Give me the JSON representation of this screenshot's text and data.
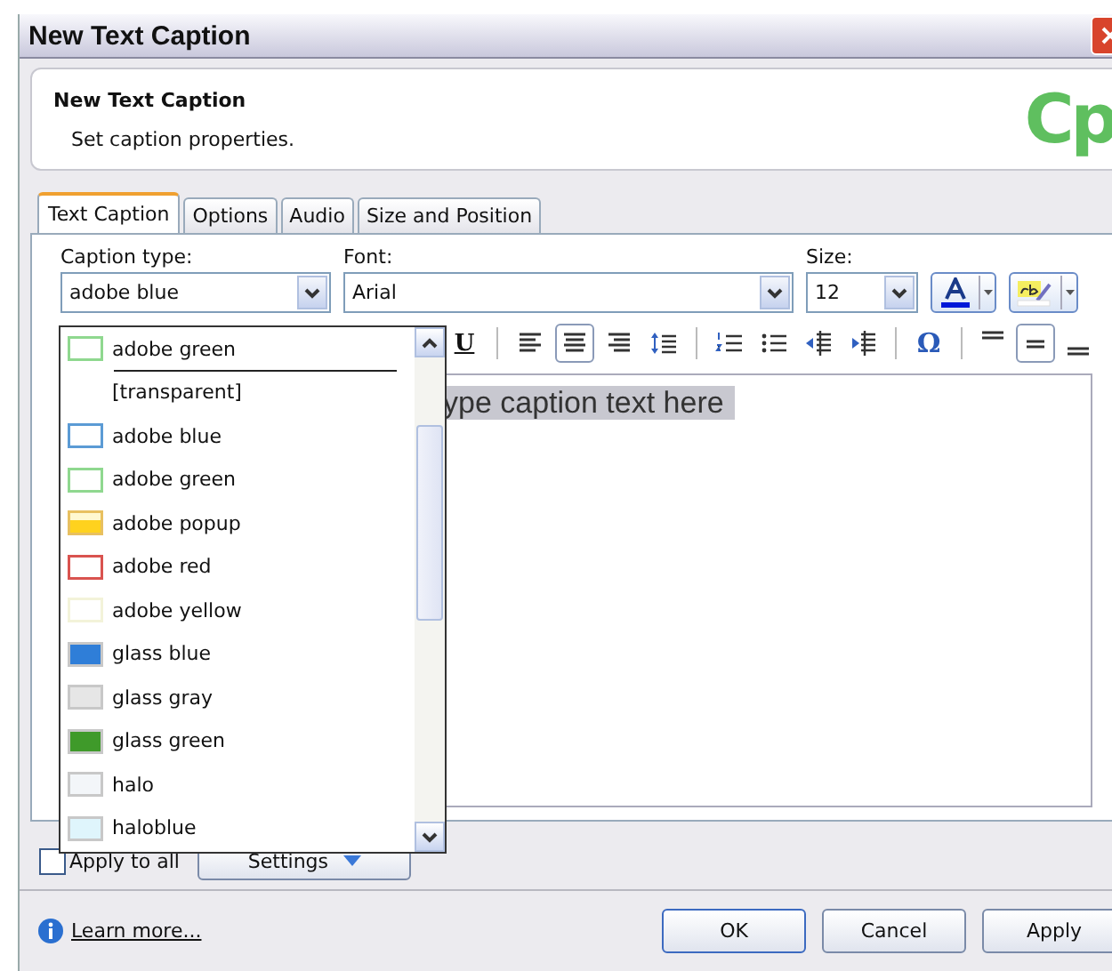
{
  "window": {
    "title": "New Text Caption"
  },
  "header": {
    "title": "New Text Caption",
    "subtitle": "Set caption properties.",
    "logo": "Cp"
  },
  "tabs": [
    {
      "label": "Text Caption",
      "selected": true
    },
    {
      "label": "Options",
      "selected": false
    },
    {
      "label": "Audio",
      "selected": false
    },
    {
      "label": "Size and Position",
      "selected": false
    }
  ],
  "caption_type": {
    "label": "Caption type:",
    "value": "adobe blue"
  },
  "font": {
    "label": "Font:",
    "value": "Arial"
  },
  "size": {
    "label": "Size:",
    "value": "12"
  },
  "toolbar": [
    {
      "kind": "underline",
      "text": "U",
      "pressed": false
    },
    {
      "kind": "separator"
    },
    {
      "kind": "align-left",
      "pressed": false
    },
    {
      "kind": "align-center",
      "pressed": true
    },
    {
      "kind": "align-right",
      "pressed": false
    },
    {
      "kind": "line-spacing",
      "pressed": false
    },
    {
      "kind": "separator"
    },
    {
      "kind": "numbered-list",
      "pressed": false
    },
    {
      "kind": "bullet-list",
      "pressed": false
    },
    {
      "kind": "outdent",
      "pressed": false
    },
    {
      "kind": "indent",
      "pressed": false
    },
    {
      "kind": "separator"
    },
    {
      "kind": "symbol",
      "text": "Ω",
      "pressed": false
    },
    {
      "kind": "separator"
    },
    {
      "kind": "superscript",
      "pressed": false
    },
    {
      "kind": "baseline",
      "pressed": true
    },
    {
      "kind": "subscript",
      "pressed": false
    }
  ],
  "editor": {
    "text": "ype caption text here"
  },
  "dropdown": {
    "recent": [
      {
        "label": "adobe green",
        "kind": "outline",
        "color": "#8fd88f"
      }
    ],
    "items": [
      {
        "label": "[transparent]",
        "kind": "none"
      },
      {
        "label": "adobe blue",
        "kind": "outline",
        "color": "#5b9bd5"
      },
      {
        "label": "adobe green",
        "kind": "outline",
        "color": "#8fd88f"
      },
      {
        "label": "adobe popup",
        "kind": "gradient",
        "color": "#ffd21e"
      },
      {
        "label": "adobe red",
        "kind": "outline",
        "color": "#d9534f"
      },
      {
        "label": "adobe yellow",
        "kind": "outline",
        "color": "#f3f3d9"
      },
      {
        "label": "glass blue",
        "kind": "fill",
        "color": "#2f7ed8"
      },
      {
        "label": "glass gray",
        "kind": "fill",
        "color": "#e6e6e6"
      },
      {
        "label": "glass green",
        "kind": "fill",
        "color": "#3f9a2a"
      },
      {
        "label": "halo",
        "kind": "fill",
        "color": "#f3f6f9"
      },
      {
        "label": "haloblue",
        "kind": "fill",
        "color": "#dff5fc"
      }
    ]
  },
  "apply_to_all": {
    "label": "Apply to all",
    "checked": false
  },
  "settings_button": "Settings",
  "learn_more": "Learn more...",
  "buttons": [
    "OK",
    "Cancel",
    "Apply"
  ]
}
